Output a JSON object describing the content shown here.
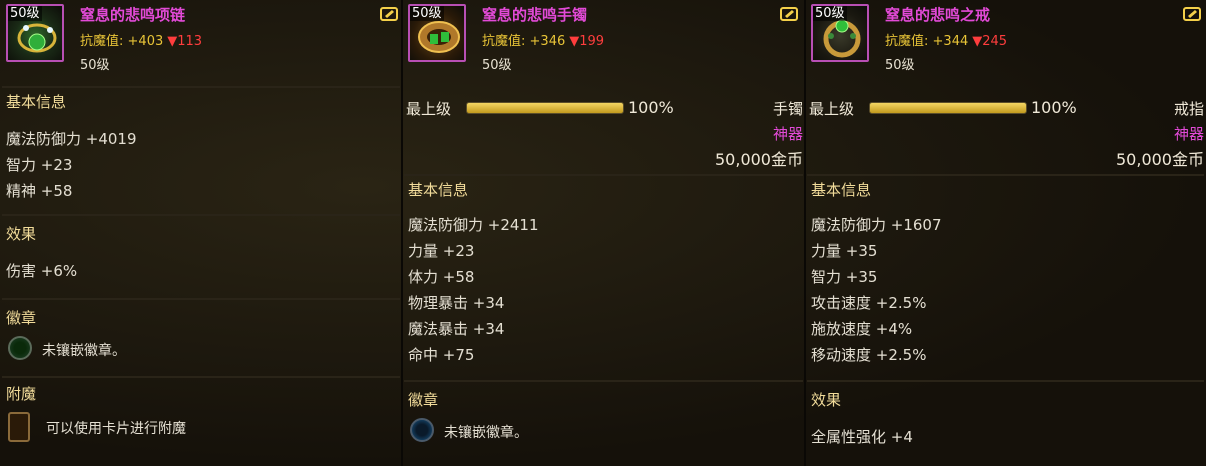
{
  "colors": {
    "name": "#e24ad7",
    "stat_label": "#e8c437",
    "decrease": "#ff3d3d",
    "section": "#f2dc9a",
    "bar_fill": "#d9b23a"
  },
  "panels": [
    {
      "icon": "necklace-icon",
      "level_tag": "50级",
      "name": "窒息的悲鸣项链",
      "stat_label": "抗魔值:",
      "stat_value": "+403",
      "stat_down": "▼113",
      "req_level": "50级",
      "basic_title": "基本信息",
      "basic_lines": [
        "魔法防御力 +4019",
        "智力 +23",
        "精神 +58"
      ],
      "effect_title": "效果",
      "effect_lines": [
        "伤害 +6%"
      ],
      "emblem_title": "徽章",
      "emblem_text": "未镶嵌徽章。",
      "enchant_title": "附魔",
      "enchant_text": "可以使用卡片进行附魔"
    },
    {
      "icon": "bracelet-icon",
      "level_tag": "50级",
      "name": "窒息的悲鸣手镯",
      "stat_label": "抗魔值:",
      "stat_value": "+346",
      "stat_down": "▼199",
      "req_level": "50级",
      "grade_label": "最上级",
      "grade_pct": "100%",
      "grade_value": 1.0,
      "slot": "手镯",
      "rarity": "神器",
      "price": "50,000金币",
      "basic_title": "基本信息",
      "basic_lines": [
        "魔法防御力 +2411",
        "力量 +23",
        "体力 +58",
        "物理暴击 +34",
        "魔法暴击 +34",
        "命中 +75"
      ],
      "emblem_title": "徽章",
      "emblem_text": "未镶嵌徽章。"
    },
    {
      "icon": "ring-icon",
      "level_tag": "50级",
      "name": "窒息的悲鸣之戒",
      "stat_label": "抗魔值:",
      "stat_value": "+344",
      "stat_down": "▼245",
      "req_level": "50级",
      "grade_label": "最上级",
      "grade_pct": "100%",
      "grade_value": 1.0,
      "slot": "戒指",
      "rarity": "神器",
      "price": "50,000金币",
      "basic_title": "基本信息",
      "basic_lines": [
        "魔法防御力 +1607",
        "力量 +35",
        "智力 +35",
        "攻击速度 +2.5%",
        "施放速度 +4%",
        "移动速度 +2.5%"
      ],
      "effect_title": "效果",
      "effect_lines": [
        "全属性强化 +4"
      ]
    }
  ]
}
